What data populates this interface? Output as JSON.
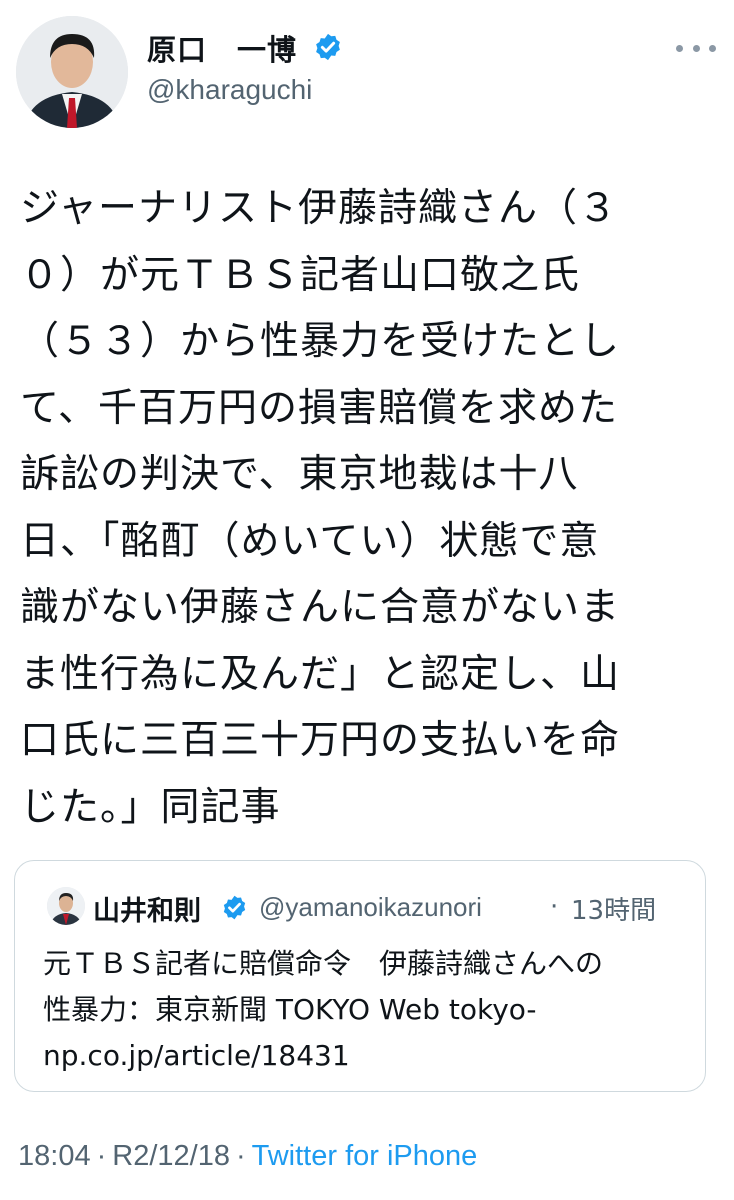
{
  "author": {
    "display_name": "原口　一博",
    "handle": "@kharaguchi"
  },
  "tweet": {
    "text": "ジャーナリスト伊藤詩織さん（３\n０）が元ＴＢＳ記者山口敬之氏\n（５３）から性暴力を受けたとし\nて、千百万円の損害賠償を求めた\n訴訟の判決で、東京地裁は十八\n日、「酩酊（めいてい）状態で意\n識がない伊藤さんに合意がないま\nま性行為に及んだ」と認定し、山\n口氏に三百三十万円の支払いを命\nじた。」同記事"
  },
  "quote": {
    "display_name": "山井和則",
    "handle": "@yamanoikazunori",
    "separator": "·",
    "time": "13時間",
    "text": "元ＴＢＳ記者に賠償命令　伊藤詩織さんへの\n性暴力：東京新聞 TOKYO Web tokyo-\nnp.co.jp/article/18431"
  },
  "footer": {
    "time": "18:04",
    "date": "R2/12/18",
    "source": "Twitter for iPhone",
    "separator": "·"
  },
  "colors": {
    "text": "#0f1419",
    "secondary": "#536471",
    "accent": "#1d9bf0",
    "border": "#cfd9de"
  },
  "icons": {
    "verified": "verified-badge-icon",
    "more": "more-horizontal-icon"
  }
}
